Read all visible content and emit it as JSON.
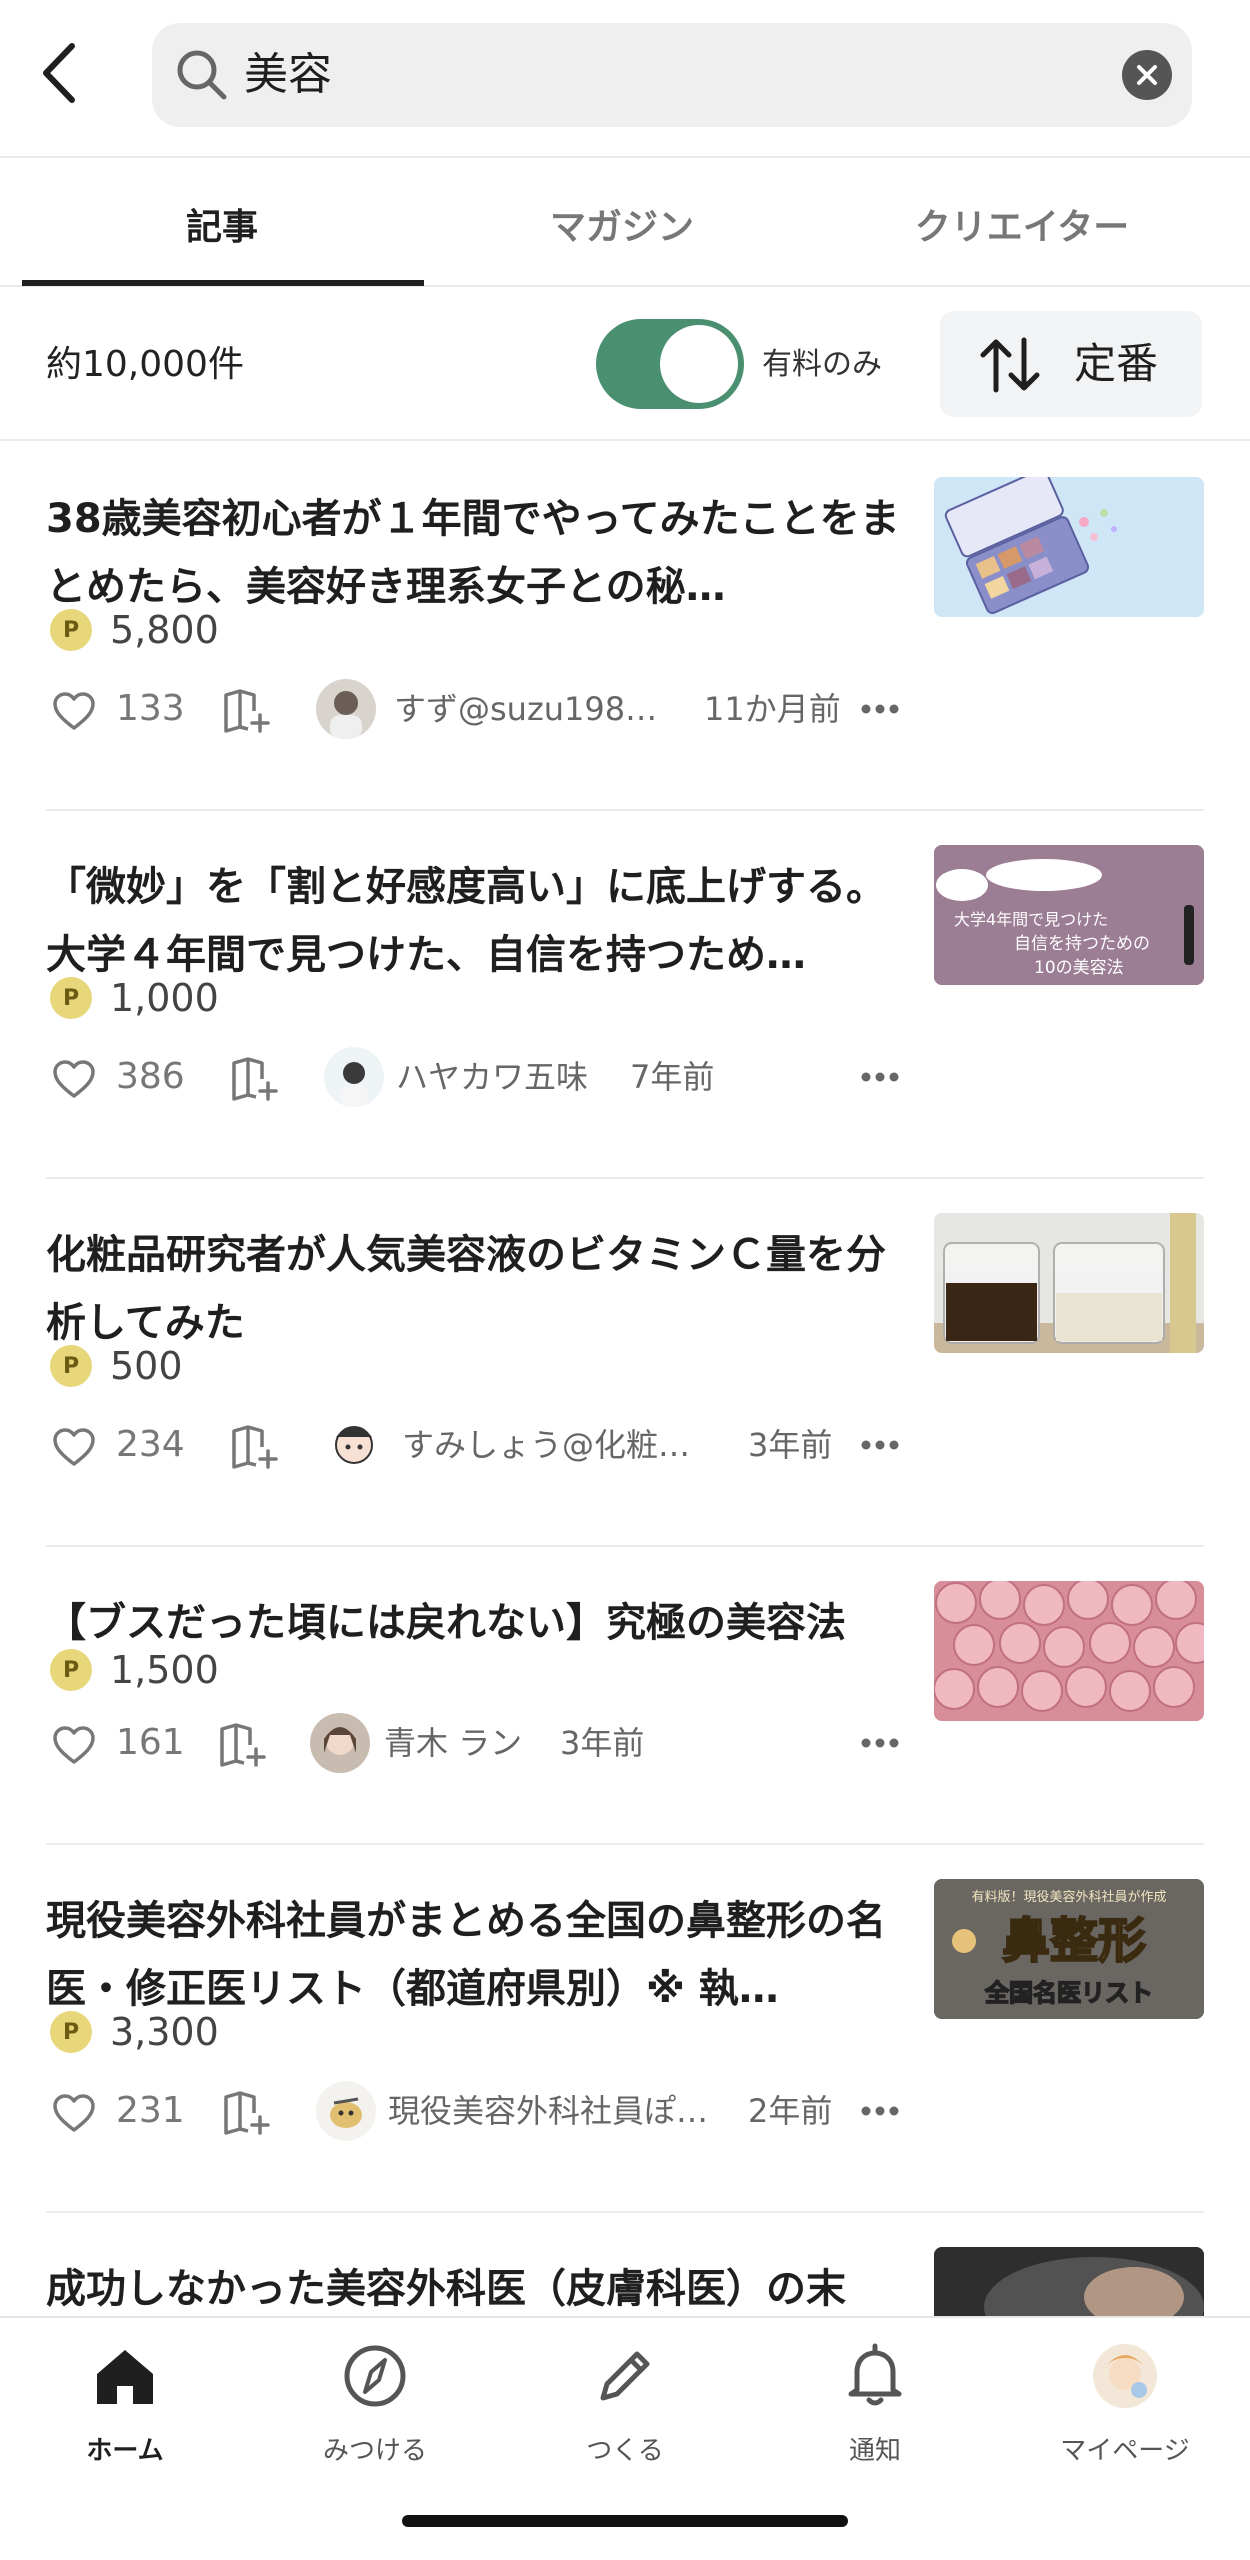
{
  "search": {
    "query": "美容"
  },
  "tabs": [
    {
      "label": "記事"
    },
    {
      "label": "マガジン"
    },
    {
      "label": "クリエイター"
    }
  ],
  "filter": {
    "count": "約10,000件",
    "toggle_label": "有料のみ",
    "toggle_on": true,
    "sort_label": "定番"
  },
  "articles": [
    {
      "title": "38歳美容初心者が１年間でやってみたことをまとめたら、美容好き理系女子との秘…",
      "price": "5,800",
      "likes": "133",
      "author": "すず@suzu198…",
      "time": "11か月前"
    },
    {
      "title": "「微妙」を「割と好感度高い」に底上げする。大学４年間で見つけた、自信を持つため…",
      "price": "1,000",
      "likes": "386",
      "author": "ハヤカワ五味",
      "time": "7年前"
    },
    {
      "title": "化粧品研究者が人気美容液のビタミンＣ量を分析してみた",
      "price": "500",
      "likes": "234",
      "author": "すみしょう@化粧…",
      "time": "3年前"
    },
    {
      "title": "【ブスだった頃には戻れない】究極の美容法",
      "price": "1,500",
      "likes": "161",
      "author": "青木 ラン",
      "time": "3年前"
    },
    {
      "title": "現役美容外科社員がまとめる全国の鼻整形の名医・修正医リスト（都道府県別）※ 執…",
      "price": "3,300",
      "likes": "231",
      "author": "現役美容外科社員ぽ…",
      "time": "2年前"
    },
    {
      "title": "成功しなかった美容外科医（皮膚科医）の末"
    }
  ],
  "thumbnails": {
    "a2_text": "「微妙」を「割と好感度高い」に底上げする。大学4年間で見つけた自信を持つための10の美容法",
    "a5_top": "有料版！現役美容外科社員が作成",
    "a5_main": "鼻整形",
    "a5_sub": "全国名医リスト"
  },
  "nav": [
    {
      "label": "ホーム",
      "icon": "home-icon"
    },
    {
      "label": "みつける",
      "icon": "compass-icon"
    },
    {
      "label": "つくる",
      "icon": "pencil-icon"
    },
    {
      "label": "通知",
      "icon": "bell-icon"
    },
    {
      "label": "マイページ",
      "icon": "avatar-icon"
    }
  ],
  "colors": {
    "toggle": "#4a8f70",
    "badge": "#e8d77a"
  }
}
